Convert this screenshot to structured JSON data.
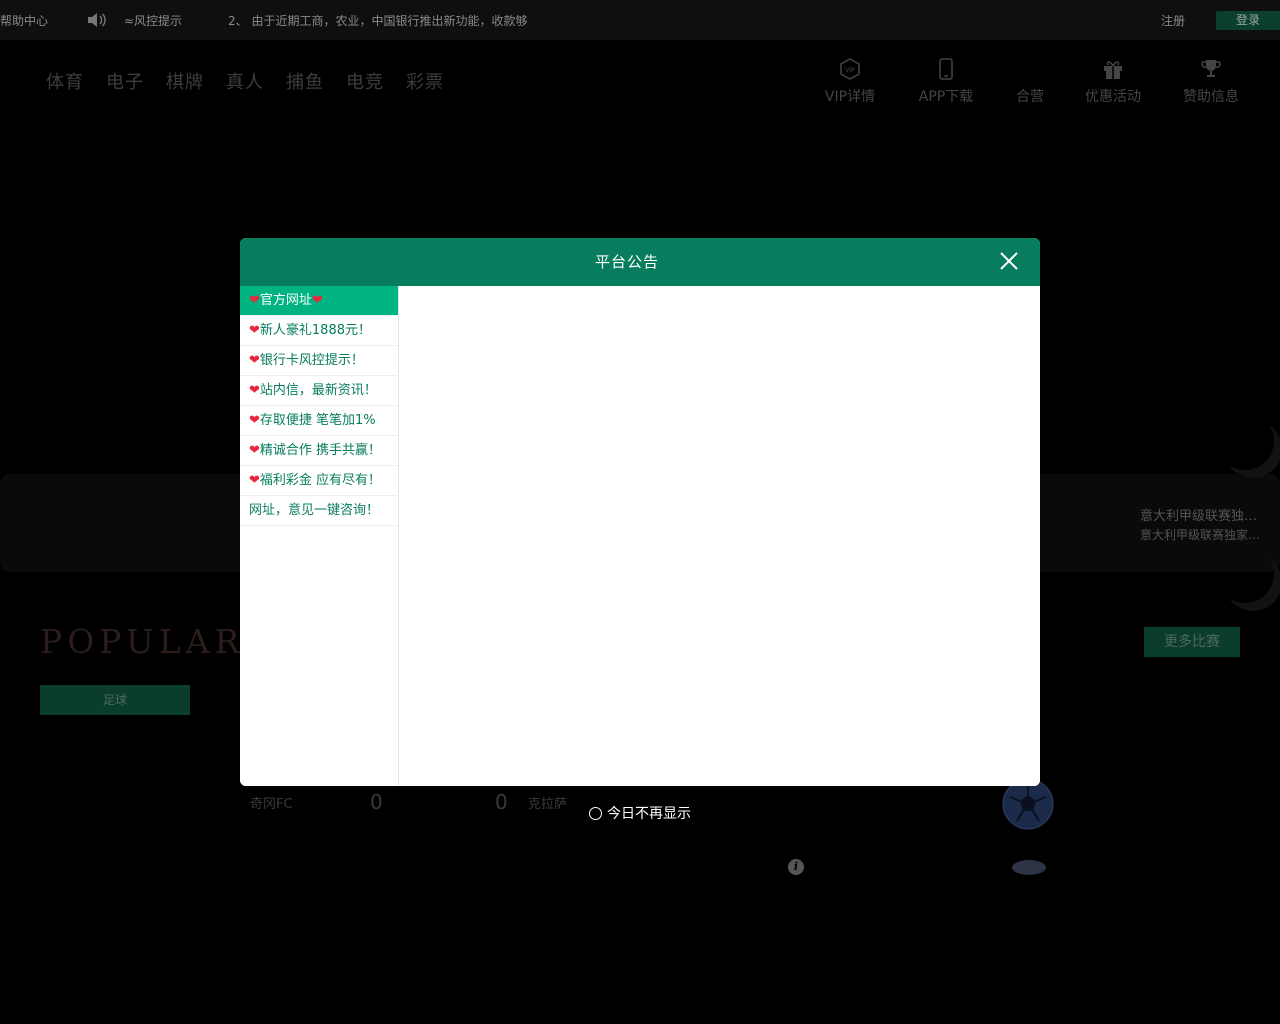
{
  "topbar": {
    "help": "帮助中心",
    "ticker_items": [
      "≈风控提示",
      "2、 由于近期工商，农业，中国银行推出新功能，收款够"
    ],
    "register": "注册",
    "login": "登录"
  },
  "nav": {
    "games": [
      "体育",
      "电子",
      "棋牌",
      "真人",
      "捕鱼",
      "电竞",
      "彩票"
    ],
    "right": [
      {
        "label": "VIP详情",
        "icon": "vip-icon"
      },
      {
        "label": "APP下载",
        "icon": "phone-icon"
      },
      {
        "label": "合营",
        "icon": "handshake-icon"
      },
      {
        "label": "优惠活动",
        "icon": "gift-icon"
      },
      {
        "label": "赞助信息",
        "icon": "trophy-icon"
      }
    ]
  },
  "background": {
    "news": [
      "意大利甲级联赛独…",
      "意大利甲级联赛独家…"
    ],
    "popular_title": "POPULAR LI",
    "more_matches": "更多比赛",
    "football_tab": "足球",
    "match": {
      "home": "奇冈FC",
      "home_score": "0",
      "away_score": "0",
      "away": "克拉萨"
    }
  },
  "modal": {
    "title": "平台公告",
    "notices": [
      {
        "text": "官方网址",
        "heart_left": true,
        "heart_right": true
      },
      {
        "text": "新人豪礼1888元！",
        "heart_left": true,
        "heart_right": false
      },
      {
        "text": "银行卡风控提示！",
        "heart_left": true,
        "heart_right": false
      },
      {
        "text": "站内信，最新资讯！",
        "heart_left": true,
        "heart_right": false
      },
      {
        "text": "存取便捷 笔笔加1%",
        "heart_left": true,
        "heart_right": false
      },
      {
        "text": "精诚合作 携手共赢！",
        "heart_left": true,
        "heart_right": false
      },
      {
        "text": "福利彩金 应有尽有！",
        "heart_left": true,
        "heart_right": false
      },
      {
        "text": "网址，意见一键咨询！",
        "heart_left": false,
        "heart_right": false
      }
    ],
    "active_index": 0,
    "dont_show": "今日不再显示"
  },
  "colors": {
    "primary": "#077d5d",
    "active_item": "#00b482",
    "heart": "#e8263c"
  }
}
